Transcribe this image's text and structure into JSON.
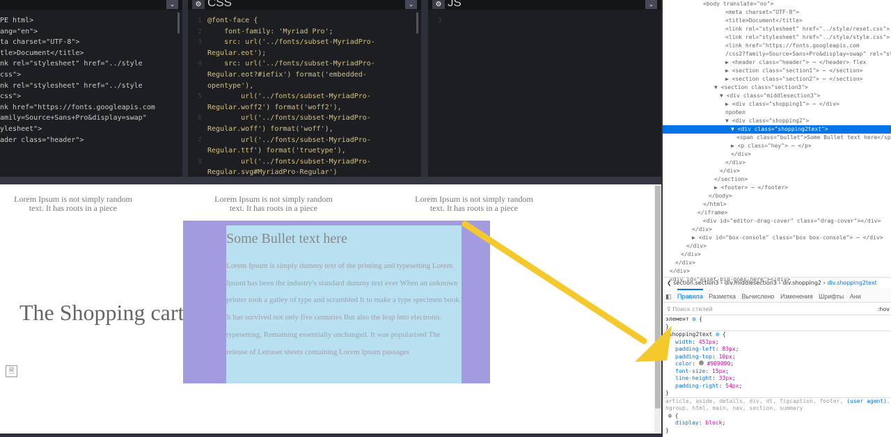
{
  "editors": {
    "html_lines": [
      "PE html>",
      "ang=\"en\">",
      "",
      "ta charset=\"UTF-8\">",
      "tle>Document</title>",
      "nk rel=\"stylesheet\" href=\"../style",
      "css\">",
      "nk rel=\"stylesheet\" href=\"../style",
      "css\">",
      "nk href=\"https://fonts.googleapis.com",
      "amily=Source+Sans+Pro&display=swap\"",
      "ylesheet\">",
      "",
      "",
      "ader class=\"header\">"
    ],
    "css_title": "CSS",
    "css_lines": [
      {
        "n": "1",
        "t": "@font-face {"
      },
      {
        "n": "2",
        "t": "    font-family: 'Myriad Pro';"
      },
      {
        "n": "3",
        "t": "    src: url('../fonts/subset-MyriadPro-"
      },
      {
        "n": "",
        "t": "Regular.eot');"
      },
      {
        "n": "4",
        "t": "    src: url('../fonts/subset-MyriadPro-"
      },
      {
        "n": "",
        "t": "Regular.eot?#iefix') format('embedded-"
      },
      {
        "n": "",
        "t": "opentype'),"
      },
      {
        "n": "5",
        "t": "        url('../fonts/subset-MyriadPro-"
      },
      {
        "n": "",
        "t": "Regular.woff2') format('woff2'),"
      },
      {
        "n": "6",
        "t": "        url('../fonts/subset-MyriadPro-"
      },
      {
        "n": "",
        "t": "Regular.woff') format('woff'),"
      },
      {
        "n": "7",
        "t": "        url('../fonts/subset-MyriadPro-"
      },
      {
        "n": "",
        "t": "Regular.ttf') format('truetype'),"
      },
      {
        "n": "8",
        "t": "        url('../fonts/subset-MyriadPro-"
      },
      {
        "n": "",
        "t": "Regular.svg#MyriadPro-Regular')"
      }
    ],
    "js_title": "JS",
    "js_line_number": "1"
  },
  "preview": {
    "lorem_short": "Lorem Ipsum is not simply random text. It has roots in a piece",
    "cart_title": "The Shopping cart",
    "bullet": "Some Bullet text here",
    "paragraph": "Lorem Ipsum is simply dummy text of the printing and typesetting Lorem Ipsum has been the industry's standard dummy text ever When an unknown printer took a galley of type and scrambled It to make a type specimen book. It has survived not only five centuries But also the leap into electronic typesetting, Remaining essentially unchanged. It was popularised The release of Letraset sheets containing Lorem Ipsum passages",
    "colors": {
      "purple": "#a39be0",
      "blue": "#b8e0f0",
      "arrow": "#f5c92e"
    }
  },
  "devtools": {
    "tree": [
      "<body translate=\"no\">",
      "<meta charset=\"UTF-8\">",
      "<title>Document</title>",
      "<link rel=\"stylesheet\" href=\"../style/reset.css\">",
      "<link rel=\"stylesheet\" href=\"../style/style.css\">",
      "<link href=\"https://fonts.googleapis.com",
      "/css2?family=Source+Sans+Pro&display=swap\" rel=\"st",
      "▶ <header class=\"header\"> ⋯ </header> flex",
      "▶ <section class=\"section1\"> ⋯ </section>",
      "▶ <section class=\"section2\"> ⋯ </section>",
      "▼ <section class=\"section3\">",
      "▼ <div class=\"middlesection3\">",
      "▶ <div class=\"shopping1\"> ⋯ </div>",
      "пробел",
      "▼ <div class=\"shopping2\">",
      "▼ <div class=\"shopping2text\">",
      "<span class=\"bullet\">Some Bullet text here</span>",
      "▶ <p class=\"hey\"> ⋯ </p>",
      "</div>",
      "</div>",
      "</div>",
      "</section>",
      "▶ <footer> ⋯ </footer>",
      "</body>",
      "</html>",
      "</iframe>",
      "<div id=\"editor-drag-cover\" class=\"drag-cover\"></div>",
      "</div>",
      "▶ <div id=\"box-console\" class=\"box box-console\"> ⋯ </div>",
      "</div>",
      "</div>",
      "</div>",
      "</div>",
      "<div id=\"asset-bin-goes-here\"></div>"
    ],
    "breadcrumbs": [
      "section.section3",
      "div.middlesection3",
      "div.shopping2",
      "div.shopping2text"
    ],
    "tabs": [
      "Правила",
      "Разметка",
      "Вычислено",
      "Изменения",
      "Шрифты",
      "Ани"
    ],
    "filter_placeholder": "Поиск стилей",
    "hov": ":hov",
    "element_rule": "элемент",
    "selector": ".shopping2text",
    "props": [
      {
        "name": "width",
        "value": "451px"
      },
      {
        "name": "padding-left",
        "value": "83px"
      },
      {
        "name": "padding-top",
        "value": "10px"
      },
      {
        "name": "color",
        "value": "#909090"
      },
      {
        "name": "font-size",
        "value": "15px"
      },
      {
        "name": "line-height",
        "value": "33px"
      },
      {
        "name": "padding-right",
        "value": "54px"
      }
    ],
    "ua_selector": "article, aside, details, div, dt, figcaption, footer, form, header, hgroup, html, main, nav, section, summary",
    "ua_label": "(user agent)",
    "ua_prop": {
      "name": "display",
      "value": "block"
    }
  }
}
